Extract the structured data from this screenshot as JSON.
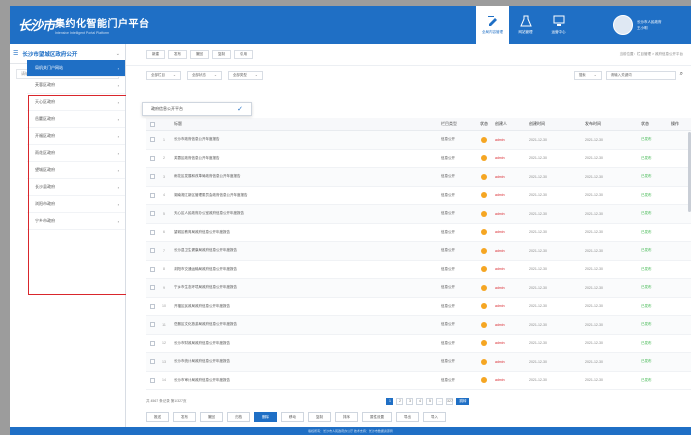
{
  "header": {
    "logo_text": "长沙市",
    "title": "集约化智能门户平台",
    "subtitle": "Intensive Intelligent Portal Platform",
    "nav": [
      {
        "label": "全局内容管理",
        "icon": "edit-icon",
        "active": true
      },
      {
        "label": "网站管理",
        "icon": "flask-icon",
        "active": false
      },
      {
        "label": "运营中心",
        "icon": "monitor-icon",
        "active": false
      }
    ],
    "user": {
      "line1": "长沙市人民政府",
      "line2": "王小明"
    }
  },
  "sidebar": {
    "org": "长沙市望城区政府公开",
    "search_placeholder": "请输入搜索",
    "items": [
      {
        "label": "局机关门户网站",
        "active": true
      },
      {
        "label": "芙蓉区政府",
        "active": false
      },
      {
        "label": "天心区政府",
        "active": false
      },
      {
        "label": "岳麓区政府",
        "active": false
      },
      {
        "label": "开福区政府",
        "active": false
      },
      {
        "label": "雨花区政府",
        "active": false
      },
      {
        "label": "望城区政府",
        "active": false
      },
      {
        "label": "长沙县政府",
        "active": false
      },
      {
        "label": "浏阳市政府",
        "active": false
      },
      {
        "label": "宁乡市政府",
        "active": false
      }
    ]
  },
  "toolbar": {
    "buttons": [
      "新建",
      "发布",
      "撤回",
      "复制",
      "引用"
    ],
    "breadcrumb": "当前位置：栏目管理 > 政府信息公开平台"
  },
  "filters": {
    "select1": "全部栏目",
    "select2": "全部状态",
    "select3": "全部类型",
    "right1": "搜索",
    "right2": "请输入关键词"
  },
  "dropdown": {
    "label": "政府信息公开平台"
  },
  "table": {
    "headers": {
      "title": "标题",
      "type": "栏目类型",
      "status": "状态",
      "user": "创建人",
      "t1": "创建时间",
      "t2": "发布时间",
      "st": "状态",
      "op": "操作"
    },
    "rows": [
      {
        "no": "1",
        "title": "长沙市政府信息公开年度报告",
        "type": "信息公开",
        "user": "admin",
        "t1": "2021-12-30",
        "t2": "2021-12-30",
        "st": "已发布"
      },
      {
        "no": "2",
        "title": "芙蓉区政府信息公开年度报告",
        "type": "信息公开",
        "user": "admin",
        "t1": "2021-12-30",
        "t2": "2021-12-30",
        "st": "已发布"
      },
      {
        "no": "3",
        "title": "雨花区发展和改革局政府信息公开年度报告",
        "type": "信息公开",
        "user": "admin",
        "t1": "2021-12-30",
        "t2": "2021-12-30",
        "st": "已发布"
      },
      {
        "no": "4",
        "title": "湖南湘江新区管理委员会政府信息公开年度报告",
        "type": "信息公开",
        "user": "admin",
        "t1": "2021-12-30",
        "t2": "2021-12-30",
        "st": "已发布"
      },
      {
        "no": "5",
        "title": "天心区人民政府办公室政府信息公开年度报告",
        "type": "信息公开",
        "user": "admin",
        "t1": "2021-12-30",
        "t2": "2021-12-30",
        "st": "已发布"
      },
      {
        "no": "6",
        "title": "望城区教育局政府信息公开年度报告",
        "type": "信息公开",
        "user": "admin",
        "t1": "2021-12-30",
        "t2": "2021-12-30",
        "st": "已发布"
      },
      {
        "no": "7",
        "title": "长沙县卫生健康局政府信息公开年度报告",
        "type": "信息公开",
        "user": "admin",
        "t1": "2021-12-30",
        "t2": "2021-12-30",
        "st": "已发布"
      },
      {
        "no": "8",
        "title": "浏阳市交通运输局政府信息公开年度报告",
        "type": "信息公开",
        "user": "admin",
        "t1": "2021-12-30",
        "t2": "2021-12-30",
        "st": "已发布"
      },
      {
        "no": "9",
        "title": "宁乡市生态环境局政府信息公开年度报告",
        "type": "信息公开",
        "user": "admin",
        "t1": "2021-12-30",
        "t2": "2021-12-30",
        "st": "已发布"
      },
      {
        "no": "10",
        "title": "开福区民政局政府信息公开年度报告",
        "type": "信息公开",
        "user": "admin",
        "t1": "2021-12-30",
        "t2": "2021-12-30",
        "st": "已发布"
      },
      {
        "no": "11",
        "title": "岳麓区文化旅游局政府信息公开年度报告",
        "type": "信息公开",
        "user": "admin",
        "t1": "2021-12-30",
        "t2": "2021-12-30",
        "st": "已发布"
      },
      {
        "no": "12",
        "title": "长沙市财政局政府信息公开年度报告",
        "type": "信息公开",
        "user": "admin",
        "t1": "2021-12-30",
        "t2": "2021-12-30",
        "st": "已发布"
      },
      {
        "no": "13",
        "title": "长沙市统计局政府信息公开年度报告",
        "type": "信息公开",
        "user": "admin",
        "t1": "2021-12-30",
        "t2": "2021-12-30",
        "st": "已发布"
      },
      {
        "no": "14",
        "title": "长沙市审计局政府信息公开年度报告",
        "type": "信息公开",
        "user": "admin",
        "t1": "2021-12-30",
        "t2": "2021-12-30",
        "st": "已发布"
      }
    ]
  },
  "pager": {
    "summary": "共 4567 条记录  第1/327页",
    "pages": [
      "1",
      "2",
      "3",
      "4",
      "5",
      "...",
      "327"
    ],
    "go": "跳转"
  },
  "bottom_buttons": [
    "推送",
    "发布",
    "撤回",
    "归档",
    "删除",
    "移动",
    "复制",
    "排序",
    "属性设置",
    "导出",
    "导入"
  ],
  "footer": "版权所有：长沙市人民政府办公厅  技术支持：长沙市数据资源局"
}
